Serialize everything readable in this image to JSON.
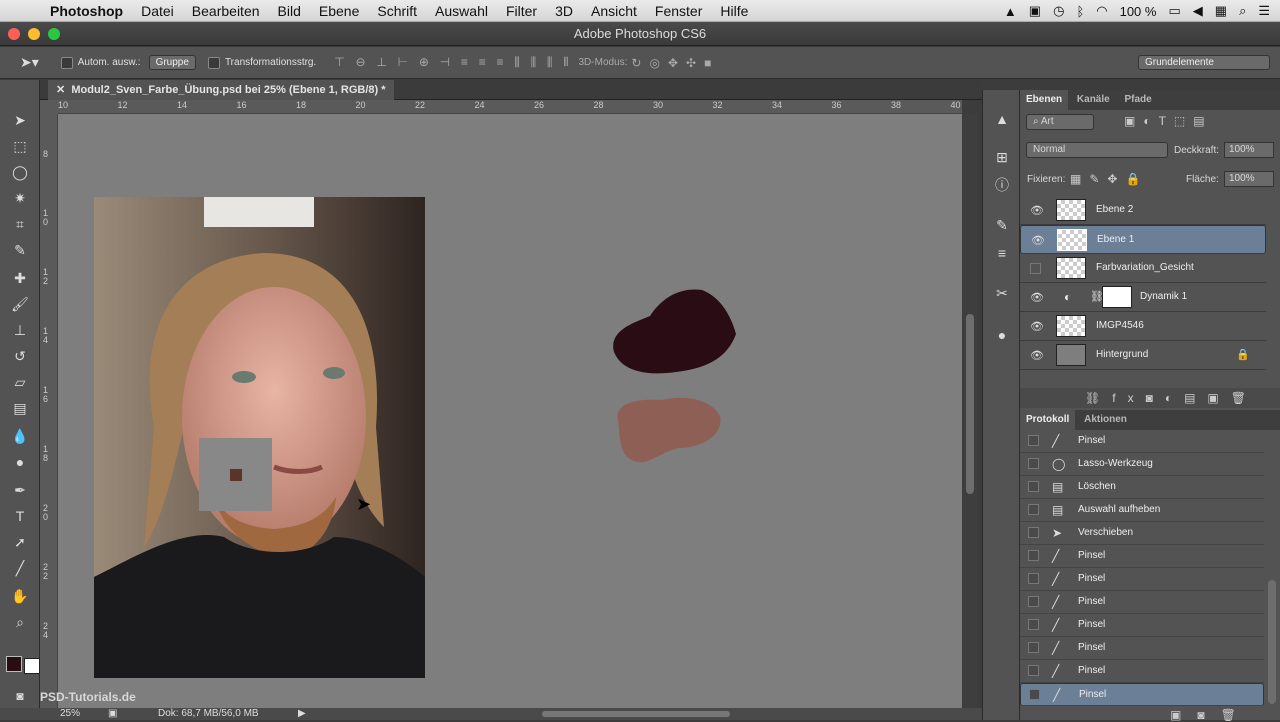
{
  "menubar": {
    "apple": "",
    "items": [
      "Photoshop",
      "Datei",
      "Bearbeiten",
      "Bild",
      "Ebene",
      "Schrift",
      "Auswahl",
      "Filter",
      "3D",
      "Ansicht",
      "Fenster",
      "Hilfe"
    ],
    "battery": "100 %"
  },
  "window": {
    "title": "Adobe Photoshop CS6"
  },
  "options": {
    "auto_select_label": "Autom. ausw.:",
    "auto_select_value": "Gruppe",
    "transform_label": "Transformationsstrg.",
    "mode3d_label": "3D-Modus:",
    "workspace": "Grundelemente"
  },
  "document": {
    "tab_label": "Modul2_Sven_Farbe_Übung.psd bei 25% (Ebene 1, RGB/8) *",
    "ruler_top": [
      "10",
      "12",
      "14",
      "16",
      "18",
      "20",
      "22",
      "24",
      "26",
      "28",
      "30",
      "32",
      "34",
      "36",
      "38",
      "40"
    ],
    "ruler_left": [
      "8",
      "10",
      "12",
      "14",
      "16",
      "18",
      "20",
      "22",
      "24"
    ],
    "watermark": "PSD-Tutorials.de"
  },
  "status": {
    "zoom": "25%",
    "doc": "Dok: 68,7 MB/56,0 MB"
  },
  "layers_panel": {
    "tabs": [
      "Ebenen",
      "Kanäle",
      "Pfade"
    ],
    "filter": "Art",
    "blend_mode": "Normal",
    "opacity_label": "Deckkraft:",
    "opacity_value": "100%",
    "lock_label": "Fixieren:",
    "fill_label": "Fläche:",
    "fill_value": "100%",
    "layers": [
      {
        "name": "Ebene 2"
      },
      {
        "name": "Ebene 1"
      },
      {
        "name": "Farbvariation_Gesicht"
      },
      {
        "name": "Dynamik 1"
      },
      {
        "name": "IMGP4546"
      },
      {
        "name": "Hintergrund"
      }
    ]
  },
  "history_panel": {
    "tabs": [
      "Protokoll",
      "Aktionen"
    ],
    "items": [
      "Pinsel",
      "Lasso-Werkzeug",
      "Löschen",
      "Auswahl aufheben",
      "Verschieben",
      "Pinsel",
      "Pinsel",
      "Pinsel",
      "Pinsel",
      "Pinsel",
      "Pinsel",
      "Pinsel"
    ]
  },
  "colors": {
    "accent": "#6b7f96",
    "foreground": "#2a0d10",
    "background": "#ffffff"
  }
}
